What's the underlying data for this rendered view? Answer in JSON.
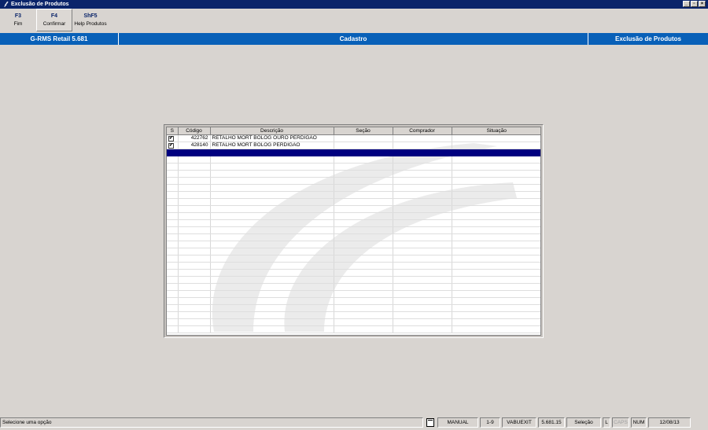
{
  "window": {
    "title": "Exclusão de Produtos",
    "controls": {
      "minimize": "_",
      "restore": "▫",
      "close": "×"
    }
  },
  "toolbar": [
    {
      "key": "F3",
      "label": "Fim"
    },
    {
      "key": "F4",
      "label": "Confirmar"
    },
    {
      "key": "ShF5",
      "label": "Help Produtos"
    }
  ],
  "header": {
    "app": "G-RMS Retail 5.681",
    "module": "Cadastro",
    "screen": "Exclusão de Produtos"
  },
  "grid": {
    "columns": [
      "S",
      "Código",
      "Descrição",
      "Seção",
      "Comprador",
      "Situação"
    ],
    "rows": [
      {
        "selected": true,
        "codigo": "422762",
        "descricao": "RETALHO MORT BOLOG OURO PERDIGAO",
        "secao": "",
        "comprador": "",
        "situacao": ""
      },
      {
        "selected": true,
        "codigo": "428140",
        "descricao": "RETALHO MORT BOLOG PERDIGAO",
        "secao": "",
        "comprador": "",
        "situacao": ""
      }
    ],
    "highlighted_row": 3,
    "checkmark": "✔"
  },
  "statusbar": {
    "message": "Selecione uma opção",
    "icon": "document-icon",
    "mode": "MANUAL",
    "range": "1-9",
    "program": "VABUEXIT",
    "version": "5.681.15",
    "state": "Seleção",
    "lock": "L",
    "caps": "CAPS",
    "num": "NUM",
    "date": "12/08/13"
  },
  "colors": {
    "titlebar": "#0a246a",
    "header": "#0860b8",
    "selection": "#000080",
    "background": "#d8d4d0"
  }
}
